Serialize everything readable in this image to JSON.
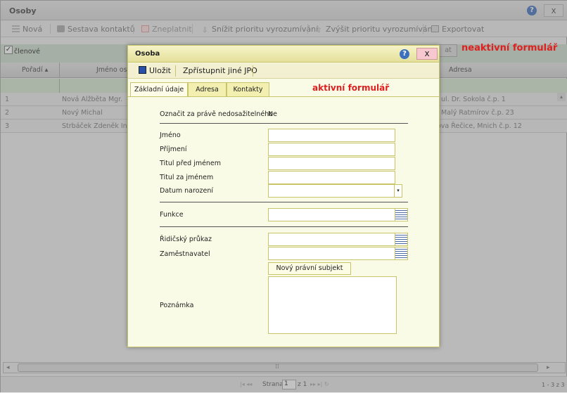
{
  "window": {
    "title": "Osoby",
    "close_label": "x"
  },
  "toolbar": {
    "new_label": "Nová",
    "contacts_label": "Sestava kontaktů",
    "invalidate_label": "Zneplatnit",
    "lower_priority_label": "Snížit prioritu vyrozumívání",
    "raise_priority_label": "Zvýšit prioritu vyrozumívání",
    "export_label": "Exportovat"
  },
  "filter": {
    "members_label": "členové",
    "filter_button_label": "at"
  },
  "grid": {
    "columns": [
      "Pořadí",
      "Jméno osob",
      "Adresa"
    ],
    "rows": [
      {
        "order": "1",
        "name": "Nová Alžběta Mgr.",
        "address": ", ul. Dr. Sokola č.p. 1"
      },
      {
        "order": "2",
        "name": "Nový Michal",
        "address": ", Malý Ratmírov č.p. 23"
      },
      {
        "order": "3",
        "name": "Strbáček Zdeněk Ing.,",
        "address": "ova Řečice, Mnich č.p. 12"
      }
    ]
  },
  "annotations": {
    "inactive": "neaktivní formulář",
    "active": "aktivní formulář"
  },
  "modal": {
    "title": "Osoba",
    "close_label": "x",
    "save_label": "Uložit",
    "share_label": "Zpřístupnit jiné JPO",
    "tabs": [
      "Základní údaje",
      "Adresa",
      "Kontakty"
    ],
    "unreachable_label": "Označit za právě nedosažitelného",
    "unreachable_value": "Ne",
    "first_name_label": "Jméno",
    "last_name_label": "Příjmení",
    "title_before_label": "Titul před jménem",
    "title_after_label": "Titul za jménem",
    "birth_date_label": "Datum narození",
    "function_label": "Funkce",
    "license_label": "Řidičský průkaz",
    "employer_label": "Zaměstnavatel",
    "new_subject_label": "Nový právní subjekt",
    "note_label": "Poznámka"
  },
  "pager": {
    "page_label": "Strana",
    "page_value": "1",
    "of_label": "z 1",
    "range_label": "1 - 3 z 3"
  },
  "colors": {
    "modal_bg": "#fafbe6",
    "modal_border": "#c8c46a",
    "annotation": "#e02020",
    "help": "#3d6fbf"
  }
}
